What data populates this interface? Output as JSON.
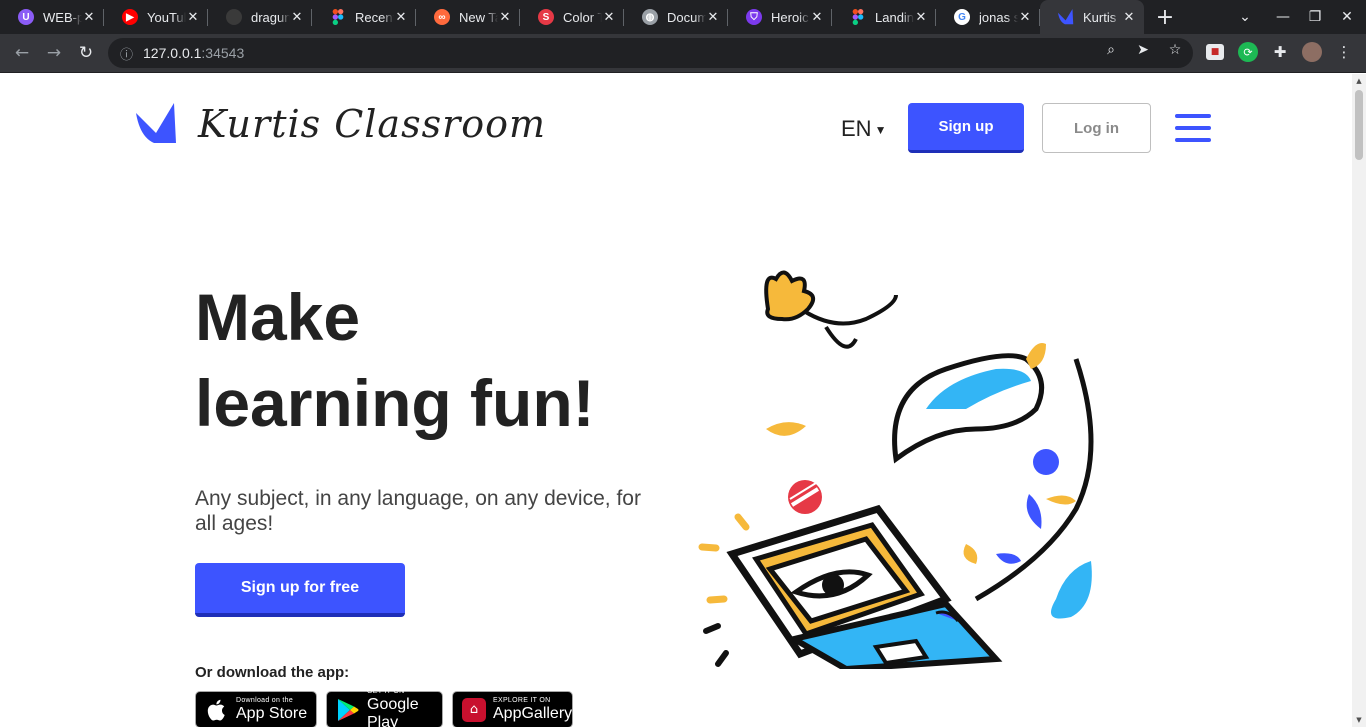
{
  "browser": {
    "tabs": [
      {
        "title": "WEB-p",
        "favicon": "proton-icon",
        "color": "#8b5cf6",
        "glyph": "U"
      },
      {
        "title": "YouTul",
        "favicon": "youtube-icon",
        "color": "#ff0000",
        "glyph": "▶"
      },
      {
        "title": "dragun",
        "favicon": "github-icon",
        "color": "#3a3a3a",
        "glyph": ""
      },
      {
        "title": "Recent",
        "favicon": "figma-icon",
        "color": "#f24e1e",
        "glyph": ""
      },
      {
        "title": "New Ta",
        "favicon": "infinity-icon",
        "color": "#ff6a3d",
        "glyph": "∞"
      },
      {
        "title": "Color T",
        "favicon": "s-icon",
        "color": "#e63946",
        "glyph": "S"
      },
      {
        "title": "Docum",
        "favicon": "globe-icon",
        "color": "#9aa0a6",
        "glyph": "◍"
      },
      {
        "title": "Heroic",
        "favicon": "shield-icon",
        "color": "#7c3aed",
        "glyph": "⛉"
      },
      {
        "title": "Landin",
        "favicon": "figma-icon",
        "color": "#f24e1e",
        "glyph": ""
      },
      {
        "title": "jonas s",
        "favicon": "google-icon",
        "color": "#ffffff",
        "glyph": "G"
      },
      {
        "title": "Kurtis",
        "favicon": "kurtis-icon",
        "color": "#3d54ff",
        "glyph": ""
      }
    ],
    "active_tab": 10,
    "url_host": "127.0.0.1",
    "url_port": ":34543"
  },
  "header": {
    "logo_text": "Kurtis Classroom",
    "language": "EN",
    "signup_label": "Sign up",
    "login_label": "Log in"
  },
  "hero": {
    "title_line1": "Make",
    "title_line2": "learning fun!",
    "subtitle": "Any subject, in any language, on any device, for all ages!",
    "cta_label": "Sign up for free",
    "download_label": "Or download the app:"
  },
  "stores": [
    {
      "small": "Download on the",
      "big": "App Store",
      "icon": "apple-icon"
    },
    {
      "small": "GET IT ON",
      "big": "Google Play",
      "icon": "google-play-icon"
    },
    {
      "small": "EXPLORE IT ON",
      "big": "AppGallery",
      "icon": "huawei-icon"
    }
  ],
  "colors": {
    "brand": "#3d54ff",
    "ink": "#222222",
    "accent_yellow": "#f6b93b",
    "accent_blue": "#33b5f5",
    "accent_red": "#e63946"
  }
}
